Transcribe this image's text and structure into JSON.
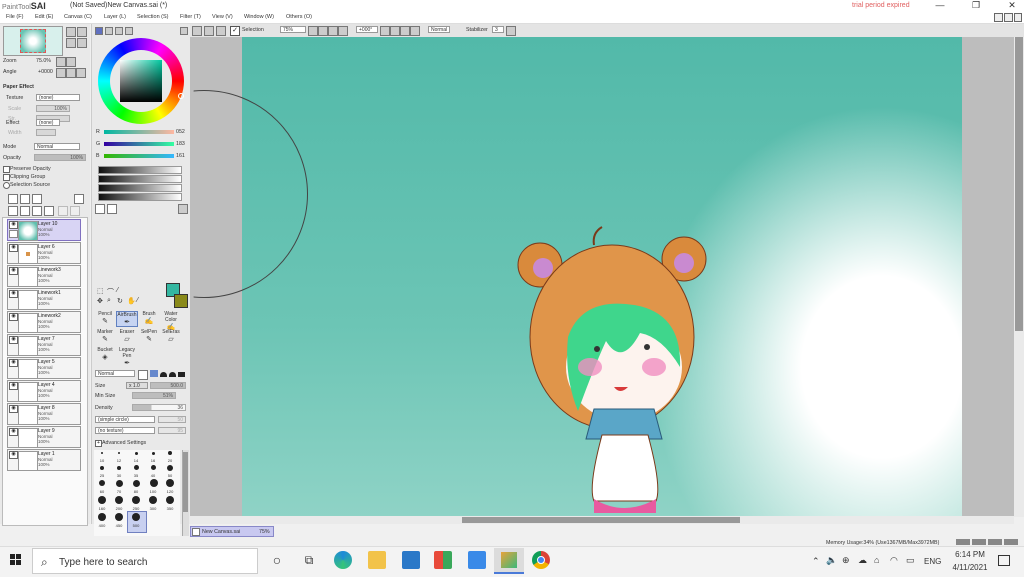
{
  "titlebar": {
    "app_prefix": "PaintTool",
    "app_name": "SAI",
    "document": "(Not Saved)New Canvas.sai (*)",
    "trial_notice": "trial period expired",
    "buttons": {
      "minimize": "—",
      "maximize": "❐",
      "close": "✕"
    }
  },
  "menu": [
    "File (F)",
    "Edit (E)",
    "Canvas (C)",
    "Layer (L)",
    "Selection (S)",
    "Filter (T)",
    "View (V)",
    "Window (W)",
    "Others (O)"
  ],
  "toolbar": {
    "selection_label": "Selection",
    "zoom": "75%",
    "rotation": "+000°",
    "blend_mode": "Normal",
    "stabilizer_label": "Stabilizer",
    "stabilizer_value": "3"
  },
  "navigator": {
    "zoom_label": "Zoom",
    "zoom_value": "75.0%",
    "angle_label": "Angle",
    "angle_value": "+0000"
  },
  "paper_effect": {
    "header": "Paper Effect",
    "texture_label": "Texture",
    "texture_value": "(none)",
    "scale_label": "Scale",
    "scale_value": "100%",
    "strength_label": "Str.",
    "effect_label": "Effect",
    "effect_value": "(none)",
    "width_label": "Width"
  },
  "layer_props": {
    "mode_label": "Mode",
    "mode_value": "Normal",
    "opacity_label": "Opacity",
    "opacity_value": "100%",
    "preserve_opacity": "Preserve Opacity",
    "clipping_group": "Clipping Group",
    "selection_source": "Selection Source"
  },
  "layers": [
    {
      "name": "Layer 10",
      "mode": "Normal",
      "opacity": "100%",
      "selected": true
    },
    {
      "name": "Layer 6",
      "mode": "Normal",
      "opacity": "100%",
      "selected": false
    },
    {
      "name": "Linework3",
      "mode": "Normal",
      "opacity": "100%",
      "selected": false
    },
    {
      "name": "Linework1",
      "mode": "Normal",
      "opacity": "100%",
      "selected": false
    },
    {
      "name": "Linework2",
      "mode": "Normal",
      "opacity": "100%",
      "selected": false
    },
    {
      "name": "Layer 7",
      "mode": "Normal",
      "opacity": "100%",
      "selected": false
    },
    {
      "name": "Layer 5",
      "mode": "Normal",
      "opacity": "100%",
      "selected": false
    },
    {
      "name": "Layer 4",
      "mode": "Normal",
      "opacity": "100%",
      "selected": false
    },
    {
      "name": "Layer 8",
      "mode": "Normal",
      "opacity": "100%",
      "selected": false
    },
    {
      "name": "Layer 9",
      "mode": "Normal",
      "opacity": "100%",
      "selected": false
    },
    {
      "name": "Layer 1",
      "mode": "Normal",
      "opacity": "100%",
      "selected": false
    }
  ],
  "color": {
    "r_label": "R",
    "r_value": "052",
    "g_label": "G",
    "g_value": "183",
    "b_label": "B",
    "b_value": "161",
    "main": "#34b7a1",
    "sub": "#8a8a1a"
  },
  "tools": {
    "row1": [
      "Pencil",
      "AirBrush",
      "Brush",
      "Water Color"
    ],
    "row2": [
      "Marker",
      "Eraser",
      "SelPen",
      "SelEras"
    ],
    "row3": [
      "Bucket",
      "Legacy Pen"
    ]
  },
  "brush": {
    "mode": "Normal",
    "size_label": "Size",
    "size_mult": "x 1.0",
    "size_value": "500.0",
    "min_size_label": "Min Size",
    "min_size_value": "51%",
    "density_label": "Density",
    "density_value": "36",
    "shape": "(simple circle)",
    "shape_value": "50",
    "texture": "(no texture)",
    "texture_value": "95",
    "advanced": "Advanced Settings",
    "presets": [
      "10",
      "12",
      "14",
      "16",
      "20",
      "25",
      "30",
      "35",
      "40",
      "50",
      "60",
      "70",
      "80",
      "100",
      "120",
      "160",
      "200",
      "250",
      "300",
      "350",
      "400",
      "450",
      "500"
    ]
  },
  "status": {
    "canvas_tab": "New Canvas.sai",
    "canvas_zoom": "75%",
    "memory": "Memory Usage:34% (Use1367MB/Max3972MB)"
  },
  "taskbar": {
    "search_placeholder": "Type here to search",
    "time": "6:14 PM",
    "date": "4/11/2021",
    "lang": "ENG"
  }
}
